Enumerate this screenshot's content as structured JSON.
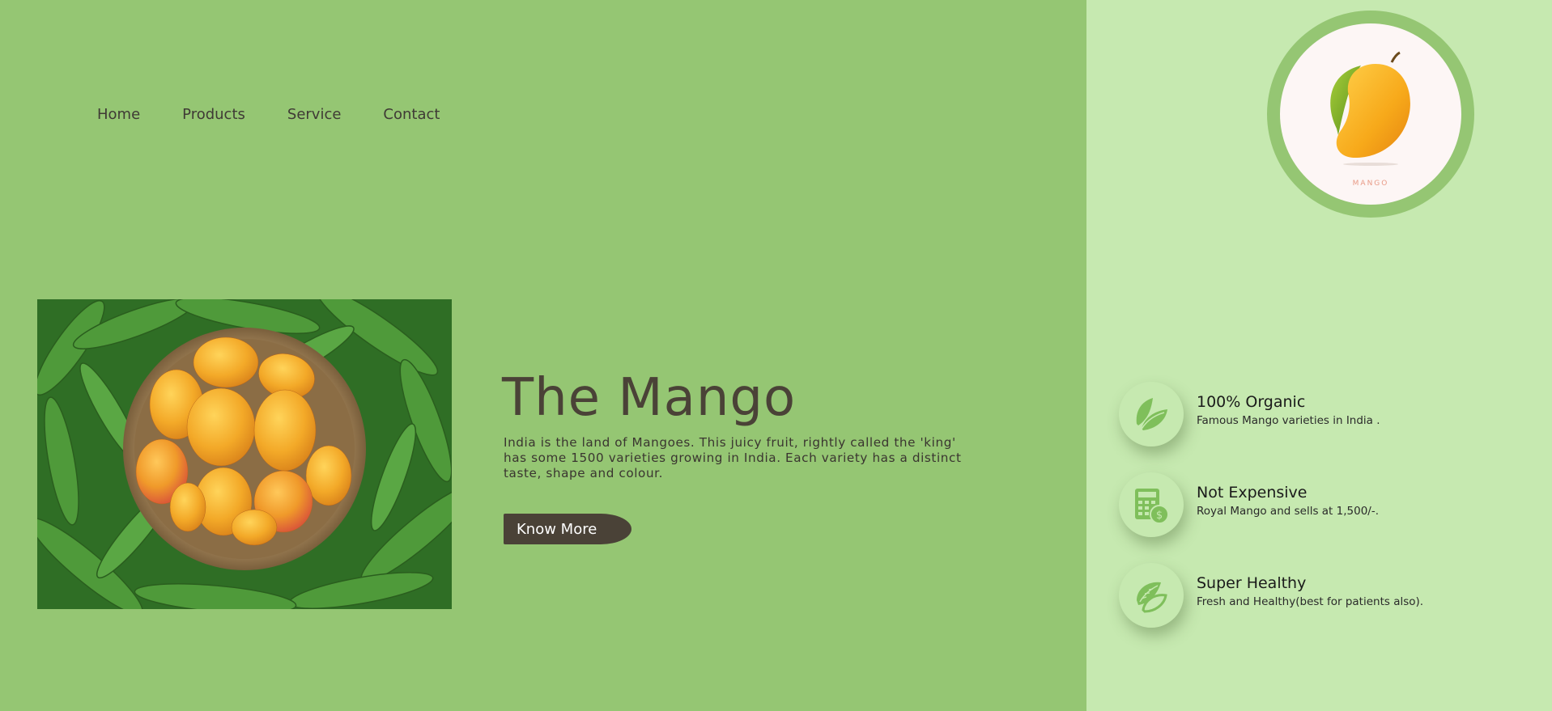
{
  "nav": {
    "items": [
      {
        "label": "Home"
      },
      {
        "label": "Products"
      },
      {
        "label": "Service"
      },
      {
        "label": "Contact"
      }
    ]
  },
  "hero": {
    "title": "The Mango",
    "description": "India is the land of Mangoes. This juicy fruit, rightly called the 'king' has some 1500 varieties growing in India. Each variety has a distinct taste, shape and colour.",
    "button_label": "Know More",
    "image_alt": "basket of mangoes on mango leaves"
  },
  "logo": {
    "text": "MANGO",
    "icon": "mango-icon"
  },
  "features": [
    {
      "icon": "leaf-icon",
      "title": "100% Organic",
      "desc": "Famous Mango varieties in India ."
    },
    {
      "icon": "calculator-money-icon",
      "title": "Not Expensive",
      "desc": "Royal Mango and sells at 1,500/-."
    },
    {
      "icon": "healthy-seeds-icon",
      "title": "Super Healthy",
      "desc": "Fresh and Healthy(best for patients also)."
    }
  ],
  "colors": {
    "left_bg": "#95c673",
    "right_bg": "#c6e9b0",
    "text_dark": "#4a4237",
    "button_bg": "#4a4237"
  }
}
